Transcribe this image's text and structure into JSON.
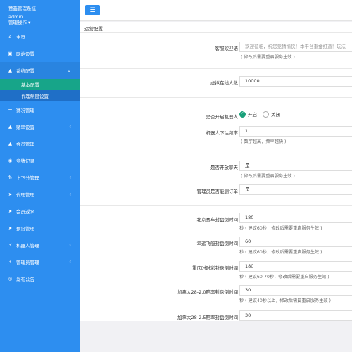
{
  "brand": {
    "title": "赞鑫管理系统",
    "user": "admin",
    "ops": "管理操作 ▾"
  },
  "menu": [
    {
      "icon": "home-icon",
      "glyph": "⌂",
      "label": "主页"
    },
    {
      "icon": "site-icon",
      "glyph": "▣",
      "label": "网站设置"
    },
    {
      "icon": "user-icon",
      "glyph": "▲",
      "label": "系统配置"
    },
    {
      "icon": "tasks-icon",
      "glyph": "☰",
      "label": "赛况管理"
    },
    {
      "icon": "bet-icon",
      "glyph": "▲",
      "label": "赌率设置"
    },
    {
      "icon": "member-icon",
      "glyph": "▲",
      "label": "会员管理"
    },
    {
      "icon": "record-icon",
      "glyph": "◉",
      "label": "竞猜记录"
    },
    {
      "icon": "updown-icon",
      "glyph": "⇅",
      "label": "上下分管理"
    },
    {
      "icon": "agent-icon",
      "glyph": "➤",
      "label": "代理管理"
    },
    {
      "icon": "backwater-icon",
      "glyph": "➤",
      "label": "会员返水"
    },
    {
      "icon": "preset-icon",
      "glyph": "➤",
      "label": "预设管理"
    },
    {
      "icon": "robot-icon",
      "glyph": "⚡",
      "label": "机器人管理"
    },
    {
      "icon": "admin-icon",
      "glyph": "⚡",
      "label": "管理员管理"
    },
    {
      "icon": "notice-icon",
      "glyph": "◎",
      "label": "发布公告"
    }
  ],
  "submenu": [
    "基本配置",
    "代理制度设置"
  ],
  "panel_title": "运营配置",
  "fields": {
    "welcome": {
      "label": "客服欢迎语",
      "placeholder": "欢迎莅临，祝您竞猜愉快！本平台重金打造！玩法",
      "help": "( 修改后需要重启服务生效 )"
    },
    "online": {
      "label": "虚拟在线人数",
      "value": "10000"
    },
    "robot": {
      "label": "是否开启机器人",
      "on": "开启",
      "off": "关闭"
    },
    "robot_freq": {
      "label": "机器人下注频率",
      "value": "1",
      "help": "( 数字越高，频率越快 )"
    },
    "chat": {
      "label": "是否开放聊天",
      "value": "是",
      "help": "( 修改后需要重启服务生效 )"
    },
    "admin_cancel": {
      "label": "管理员是否能删订单",
      "value": "是"
    },
    "bj_rate": {
      "label": "北京赛车封盘倒时间",
      "value": "180",
      "help": "秒 ( 建议60秒，修改后需要重启服务生效 )"
    },
    "xy_rate": {
      "label": "幸运飞艇封盘倒时间",
      "value": "60",
      "help": "秒 ( 建议60秒，修改后需要重启服务生效 )"
    },
    "cq_rate": {
      "label": "重庆时时彩封盘倒时间",
      "value": "180",
      "help": "秒 ( 建议60-70秒，修改后需要重启服务生效 )"
    },
    "ca28_rate": {
      "label": "加拿大28-2.0赔率封盘倒时间",
      "value": "30",
      "help": "秒 ( 建议40秒以上，修改后需要重启服务生效 )"
    },
    "ca25_rate": {
      "label": "加拿大28-2.5赔率封盘倒时间",
      "value": "30"
    }
  },
  "colors": {
    "sidebar": "#2d8ef0",
    "active_sub": "#17a589",
    "accent": "#1aa07a"
  }
}
